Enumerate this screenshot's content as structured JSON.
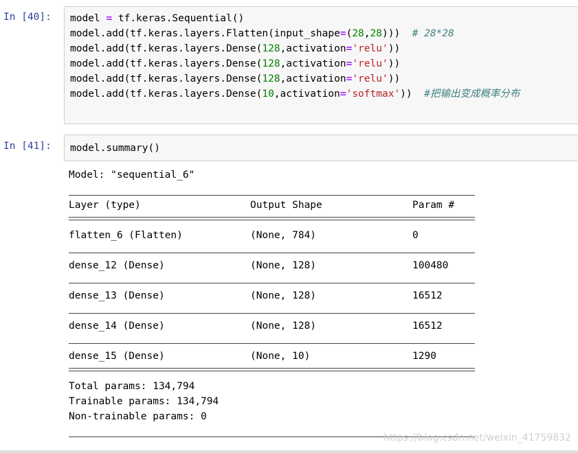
{
  "cell40": {
    "prompt": "In  [40]:",
    "lines": [
      [
        {
          "t": "model ",
          "c": ""
        },
        {
          "t": "=",
          "c": "op"
        },
        {
          "t": " tf.keras.Sequential()",
          "c": ""
        }
      ],
      [
        {
          "t": "model.add(tf.keras.layers.Flatten(input_shape",
          "c": ""
        },
        {
          "t": "=",
          "c": "op"
        },
        {
          "t": "(",
          "c": ""
        },
        {
          "t": "28",
          "c": "num"
        },
        {
          "t": ",",
          "c": ""
        },
        {
          "t": "28",
          "c": "num"
        },
        {
          "t": ")))  ",
          "c": ""
        },
        {
          "t": "# 28*28",
          "c": "cm"
        }
      ],
      [
        {
          "t": "model.add(tf.keras.layers.Dense(",
          "c": ""
        },
        {
          "t": "128",
          "c": "num"
        },
        {
          "t": ",activation",
          "c": ""
        },
        {
          "t": "=",
          "c": "op"
        },
        {
          "t": "'relu'",
          "c": "str"
        },
        {
          "t": "))",
          "c": ""
        }
      ],
      [
        {
          "t": "model.add(tf.keras.layers.Dense(",
          "c": ""
        },
        {
          "t": "128",
          "c": "num"
        },
        {
          "t": ",activation",
          "c": ""
        },
        {
          "t": "=",
          "c": "op"
        },
        {
          "t": "'relu'",
          "c": "str"
        },
        {
          "t": "))",
          "c": ""
        }
      ],
      [
        {
          "t": "model.add(tf.keras.layers.Dense(",
          "c": ""
        },
        {
          "t": "128",
          "c": "num"
        },
        {
          "t": ",activation",
          "c": ""
        },
        {
          "t": "=",
          "c": "op"
        },
        {
          "t": "'relu'",
          "c": "str"
        },
        {
          "t": "))",
          "c": ""
        }
      ],
      [
        {
          "t": "model.add(tf.keras.layers.Dense(",
          "c": ""
        },
        {
          "t": "10",
          "c": "num"
        },
        {
          "t": ",activation",
          "c": ""
        },
        {
          "t": "=",
          "c": "op"
        },
        {
          "t": "'softmax'",
          "c": "str"
        },
        {
          "t": "))  ",
          "c": ""
        },
        {
          "t": "#把输出变成概率分布",
          "c": "cm"
        }
      ]
    ]
  },
  "cell41": {
    "prompt": "In  [41]:",
    "code": "model.summary()"
  },
  "summary": {
    "model_line": "Model: \"sequential_6\"",
    "headers": [
      "Layer (type)",
      "Output Shape",
      "Param #"
    ],
    "rows": [
      [
        "flatten_6 (Flatten)",
        "(None, 784)",
        "0"
      ],
      [
        "dense_12 (Dense)",
        "(None, 128)",
        "100480"
      ],
      [
        "dense_13 (Dense)",
        "(None, 128)",
        "16512"
      ],
      [
        "dense_14 (Dense)",
        "(None, 128)",
        "16512"
      ],
      [
        "dense_15 (Dense)",
        "(None, 10)",
        "1290"
      ]
    ],
    "total": "Total params: 134,794",
    "trainable": "Trainable params: 134,794",
    "non_trainable": "Non-trainable params: 0"
  },
  "watermark": "https://blog.csdn.net/weixin_41759832",
  "colors": {
    "prompt": "#303f9f",
    "number": "#008000",
    "string": "#ba2121",
    "comment": "#408080",
    "operator": "#aa22ff"
  }
}
